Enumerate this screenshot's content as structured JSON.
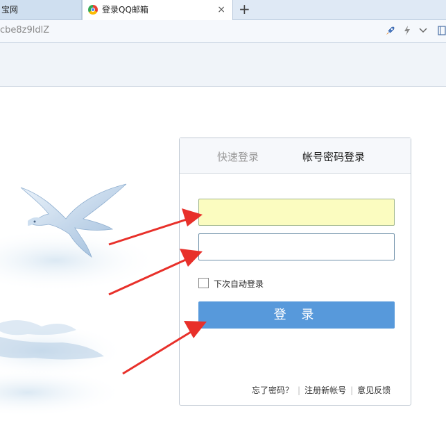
{
  "browser": {
    "tabs": [
      {
        "label": "宝网",
        "active": false
      },
      {
        "label": "登录QQ邮箱",
        "active": true
      }
    ],
    "close_icon": "×",
    "new_tab_icon": "+",
    "url": "cbe8z9ldlZ",
    "toolbar_icons": [
      "rocket-icon",
      "lightning-icon",
      "chevron-down-icon"
    ]
  },
  "login": {
    "tabs": [
      {
        "label": "快速登录"
      },
      {
        "label": "帐号密码登录"
      }
    ],
    "username_value": "",
    "password_value": "",
    "remember_label": "下次自动登录",
    "login_button": "登 录",
    "links": {
      "forgot": "忘了密码？",
      "separator": "|",
      "register": "注册新帐号",
      "feedback": "意见反馈"
    }
  },
  "colors": {
    "button": "#5799db",
    "username_bg": "#fbfcc0",
    "arrow": "#e8302a"
  }
}
